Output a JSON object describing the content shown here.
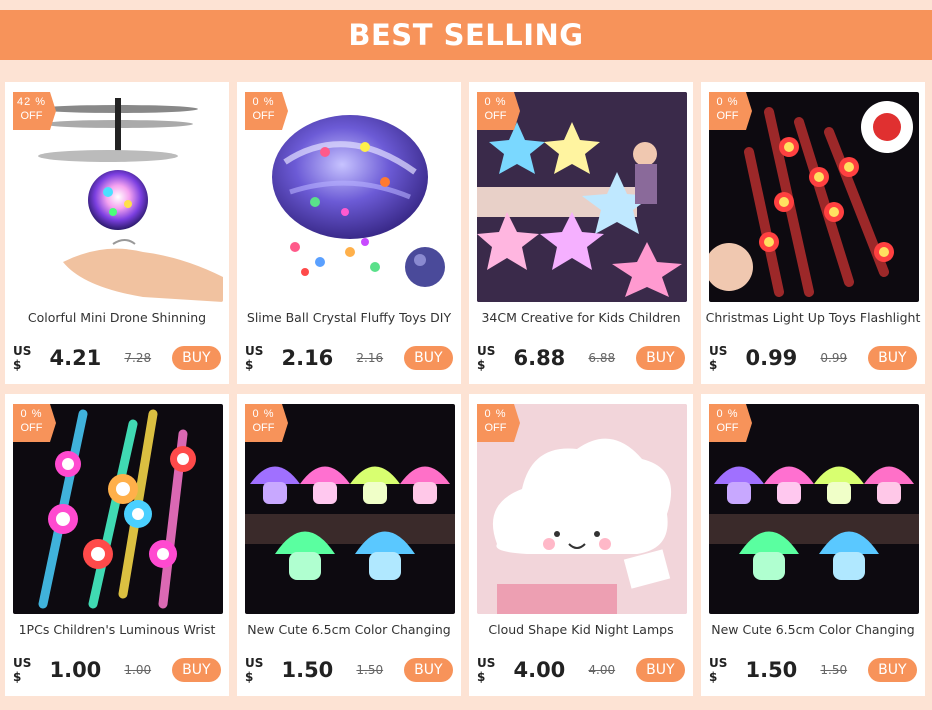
{
  "banner": {
    "title": "BEST SELLING"
  },
  "colors": {
    "accent": "#f7935a",
    "background": "#fde3d4"
  },
  "currency_label": "US $",
  "products": [
    {
      "discount_pct": "42 %",
      "discount_off": "OFF",
      "title": "Colorful Mini Drone Shinning",
      "price": "4.21",
      "old_price": "7.28",
      "buy_label": "BUY",
      "image": "drone-ball-icon"
    },
    {
      "discount_pct": "0  %",
      "discount_off": "OFF",
      "title": "Slime Ball Crystal Fluffy Toys DIY",
      "price": "2.16",
      "old_price": "2.16",
      "buy_label": "BUY",
      "image": "slime-icon"
    },
    {
      "discount_pct": "0  %",
      "discount_off": "OFF",
      "title": "34CM Creative  for Kids Children",
      "price": "6.88",
      "old_price": "6.88",
      "buy_label": "BUY",
      "image": "star-pillow-icon"
    },
    {
      "discount_pct": "0  %",
      "discount_off": "OFF",
      "title": "Christmas Light Up Toys Flashlight",
      "price": "0.99",
      "old_price": "0.99",
      "buy_label": "BUY",
      "image": "light-watch-icon"
    },
    {
      "discount_pct": "0  %",
      "discount_off": "OFF",
      "title": "1PCs Children's Luminous Wrist",
      "price": "1.00",
      "old_price": "1.00",
      "buy_label": "BUY",
      "image": "wrist-watch-icon"
    },
    {
      "discount_pct": "0  %",
      "discount_off": "OFF",
      "title": "New Cute 6.5cm Color Changing",
      "price": "1.50",
      "old_price": "1.50",
      "buy_label": "BUY",
      "image": "mushroom-lamp-icon"
    },
    {
      "discount_pct": "0  %",
      "discount_off": "OFF",
      "title": "Cloud Shape Kid  Night Lamps",
      "price": "4.00",
      "old_price": "4.00",
      "buy_label": "BUY",
      "image": "cloud-lamp-icon"
    },
    {
      "discount_pct": "0  %",
      "discount_off": "OFF",
      "title": "New Cute 6.5cm Color Changing",
      "price": "1.50",
      "old_price": "1.50",
      "buy_label": "BUY",
      "image": "mushroom-lamp-icon"
    }
  ]
}
